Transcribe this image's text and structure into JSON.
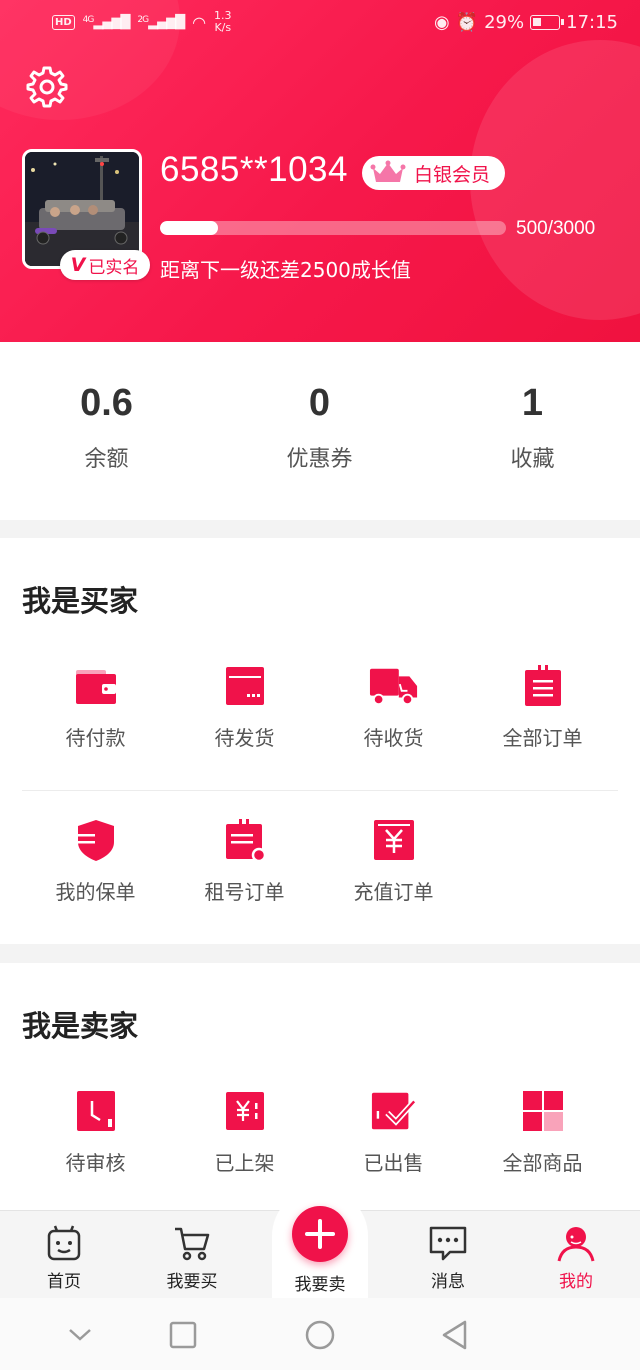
{
  "colors": {
    "accent": "#f0124a",
    "header_bg": "#f6184a"
  },
  "status_bar": {
    "hd": "HD",
    "net1": "4G",
    "net2": "2G",
    "speed_top": "1.3",
    "speed_bottom": "K/s",
    "battery": "29%",
    "time": "17:15"
  },
  "profile": {
    "username": "6585**1034",
    "member_level": "白银会员",
    "verified_label": "已实名",
    "verified_mark": "V",
    "growth_progress": "500/3000",
    "growth_fraction": 0.1667,
    "growth_hint": "距离下一级还差2500成长值"
  },
  "stats": [
    {
      "value": "0.6",
      "label": "余额"
    },
    {
      "value": "0",
      "label": "优惠券"
    },
    {
      "value": "1",
      "label": "收藏"
    }
  ],
  "buyer": {
    "title": "我是买家",
    "items": [
      {
        "label": "待付款",
        "icon": "wallet-icon"
      },
      {
        "label": "待发货",
        "icon": "package-icon"
      },
      {
        "label": "待收货",
        "icon": "truck-icon"
      },
      {
        "label": "全部订单",
        "icon": "clipboard-icon"
      },
      {
        "label": "我的保单",
        "icon": "shield-icon"
      },
      {
        "label": "租号订单",
        "icon": "rent-order-icon"
      },
      {
        "label": "充值订单",
        "icon": "yen-icon"
      }
    ]
  },
  "seller": {
    "title": "我是卖家",
    "items": [
      {
        "label": "待审核",
        "icon": "review-clock-icon"
      },
      {
        "label": "已上架",
        "icon": "listed-yen-icon"
      },
      {
        "label": "已出售",
        "icon": "sold-check-icon"
      },
      {
        "label": "全部商品",
        "icon": "grid-icon"
      }
    ]
  },
  "tabbar": {
    "home": "首页",
    "buy": "我要买",
    "sell": "我要卖",
    "messages": "消息",
    "mine": "我的",
    "active": "mine"
  }
}
